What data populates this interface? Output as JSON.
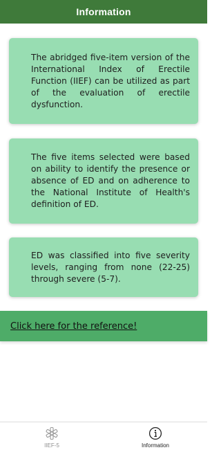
{
  "header": {
    "title": "Information"
  },
  "cards": [
    {
      "text": "The abridged five-item version of the International Index of Erectile Function (IIEF) can be utilized as part of the evaluation of erectile dysfunction."
    },
    {
      "text": "The five items selected were based on ability to identify the presence or absence of ED and on adherence to the National Institute of Health's definition of ED."
    },
    {
      "text": "ED was classified into five severity levels, ranging from none (22-25) through severe (5-7)."
    }
  ],
  "reference": {
    "link_label": "Click here for the reference!"
  },
  "tabbar": {
    "tabs": [
      {
        "label": "IIEF-5",
        "icon": "asterisk-icon",
        "active": false
      },
      {
        "label": "Information",
        "icon": "info-circle-icon",
        "active": true
      }
    ]
  },
  "colors": {
    "header": "#3f7a3a",
    "card": "#98ddb2",
    "reference_bar": "#4eac68"
  }
}
